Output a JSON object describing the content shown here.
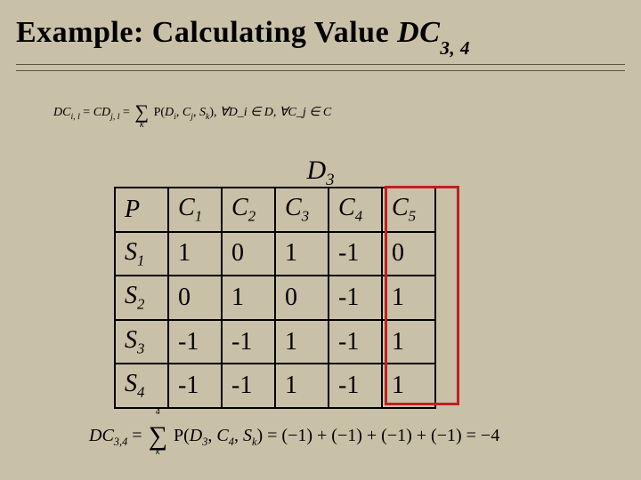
{
  "title": {
    "prefix": "Example: Calculating Value  ",
    "var": "DC",
    "sub": "3, 4"
  },
  "formula_top": {
    "lhs_var": "DC",
    "lhs_sub": "i, l",
    "eq": " = ",
    "cd_var": "CD",
    "cd_sub": "j, l",
    "eq2": " = ",
    "sum_lower": "k",
    "p_expr_open": "P(",
    "p_d": "D",
    "p_d_sub": "i",
    "p_comma1": ", ",
    "p_c": "C",
    "p_c_sub": "j",
    "p_comma2": ", ",
    "p_s": "S",
    "p_s_sub": "k",
    "p_close": "), ",
    "forall": "∀D_i ∈ D, ∀C_j ∈ C"
  },
  "d3_label": {
    "var": "D",
    "sub": "3"
  },
  "table": {
    "headers": [
      "P",
      "C1",
      "C2",
      "C3",
      "C4",
      "C5"
    ],
    "header_vars": [
      "P",
      "C",
      "C",
      "C",
      "C",
      "C"
    ],
    "header_subs": [
      "",
      "1",
      "2",
      "3",
      "4",
      "5"
    ],
    "row_labels_var": [
      "S",
      "S",
      "S",
      "S"
    ],
    "row_labels_sub": [
      "1",
      "2",
      "3",
      "4"
    ],
    "rows": [
      [
        "1",
        "0",
        "1",
        "-1",
        "0"
      ],
      [
        "0",
        "1",
        "0",
        "-1",
        "1"
      ],
      [
        "-1",
        "-1",
        "1",
        "-1",
        "1"
      ],
      [
        "-1",
        "-1",
        "1",
        "-1",
        "1"
      ]
    ]
  },
  "chart_data": {
    "type": "table",
    "title": "P(D3, Cj, Sk)",
    "columns": [
      "C1",
      "C2",
      "C3",
      "C4",
      "C5"
    ],
    "rows": [
      "S1",
      "S2",
      "S3",
      "S4"
    ],
    "values": [
      [
        1,
        0,
        1,
        -1,
        0
      ],
      [
        0,
        1,
        0,
        -1,
        1
      ],
      [
        -1,
        -1,
        1,
        -1,
        1
      ],
      [
        -1,
        -1,
        1,
        -1,
        1
      ]
    ],
    "highlight_column": "C4",
    "highlight_sum": -4
  },
  "formula_bot": {
    "lhs_var": "DC",
    "lhs_sub": "3,4",
    "eq": " = ",
    "sum_upper": "4",
    "sum_lower": "k",
    "p_open": "P(",
    "p_d": "D",
    "p_d_sub": "3",
    "p_comma1": ", ",
    "p_c": "C",
    "p_c_sub": "4",
    "p_comma2": ", ",
    "p_s": "S",
    "p_s_sub": "k",
    "p_close": ") ",
    "expansion": "= (−1) + (−1) + (−1) + (−1) = −4"
  }
}
